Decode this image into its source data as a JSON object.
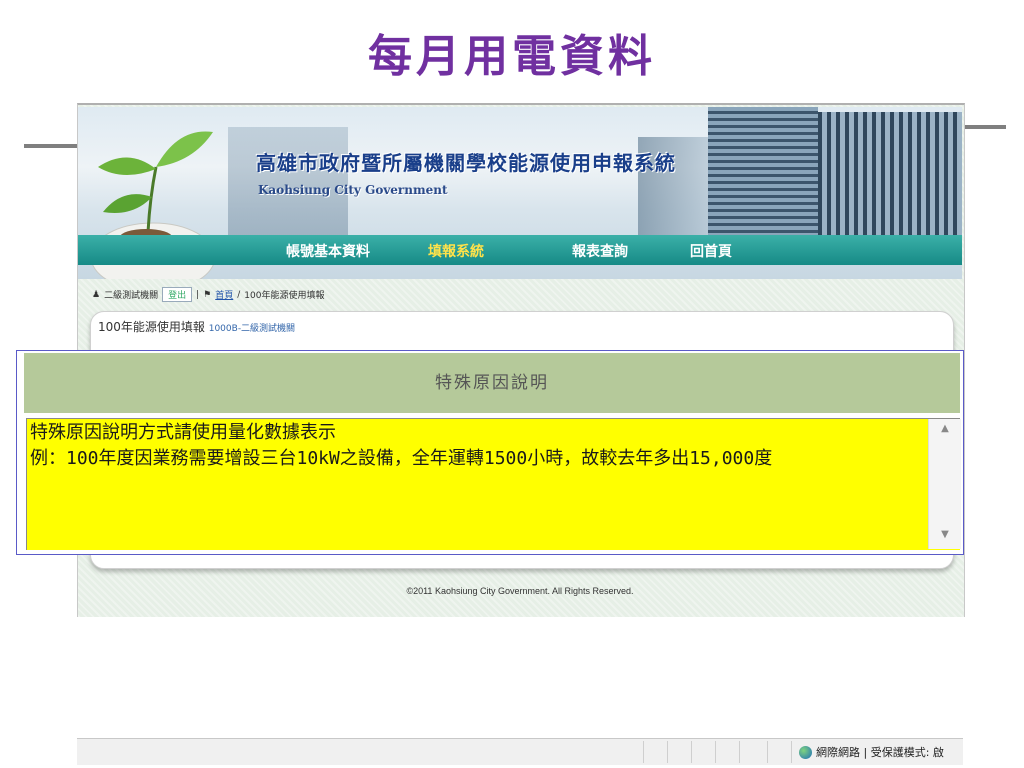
{
  "slide": {
    "title": "每月用電資料"
  },
  "site": {
    "title": "高雄市政府暨所屬機關學校能源使用申報系統",
    "subtitle": "Kaohsiung City Government"
  },
  "nav": {
    "items": [
      {
        "label": "帳號基本資料",
        "active": false
      },
      {
        "label": "填報系統",
        "active": true
      },
      {
        "label": "報表查詢",
        "active": false
      },
      {
        "label": "回首頁",
        "active": false
      }
    ]
  },
  "breadcrumb": {
    "user": "二級測試機關",
    "logout": "登出",
    "home": "首頁",
    "separator": "/",
    "current": "100年能源使用填報"
  },
  "page": {
    "heading": "100年能源使用填報",
    "heading_sub": "1000B-二級測試機關"
  },
  "popup": {
    "title": "特殊原因說明",
    "text": "特殊原因說明方式請使用量化數據表示\n例：100年度因業務需要增設三台10kW之設備，全年運轉1500小時，故較去年多出15,000度"
  },
  "footer": {
    "copyright": "©2011 Kaohsiung City Government. All Rights Reserved."
  },
  "statusbar": {
    "zone": "網際網路 | 受保護模式: 啟"
  },
  "colors": {
    "slide_title": "#7030a0",
    "nav_bg": "#168a86",
    "nav_active": "#ffe24a",
    "popup_header": "#b5c99a",
    "textarea_bg": "#ffff00"
  }
}
